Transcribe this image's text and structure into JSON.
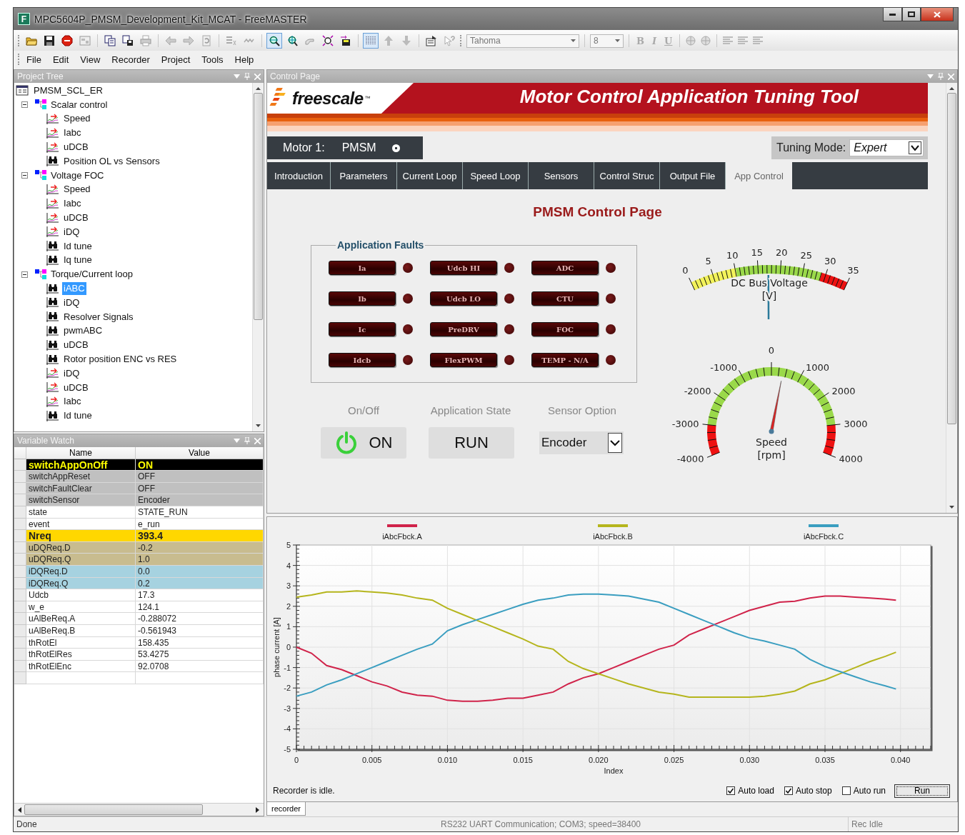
{
  "window": {
    "icon_letter": "F",
    "title": "MPC5604P_PMSM_Development_Kit_MCAT - FreeMASTER"
  },
  "toolbar": {
    "font": "Tahoma",
    "font_size": "8",
    "format_buttons": [
      {
        "label": "B",
        "disabled": true
      },
      {
        "label": "I",
        "disabled": true
      },
      {
        "label": "U",
        "disabled": true
      }
    ]
  },
  "menu": [
    "File",
    "Edit",
    "View",
    "Recorder",
    "Project",
    "Tools",
    "Help"
  ],
  "project_tree": {
    "title": "Project Tree",
    "items": [
      {
        "label": "PMSM_SCL_ER",
        "kind": "project",
        "selected": false,
        "children": [
          {
            "label": "Scalar control",
            "kind": "group",
            "expanded": true,
            "selected": false,
            "children": [
              {
                "label": "Speed",
                "kind": "recorder",
                "selected": false
              },
              {
                "label": "Iabc",
                "kind": "recorder",
                "selected": false
              },
              {
                "label": "uDCB",
                "kind": "recorder",
                "selected": false
              },
              {
                "label": "Position OL vs Sensors",
                "kind": "scope",
                "selected": false
              }
            ]
          },
          {
            "label": "Voltage FOC",
            "kind": "group",
            "expanded": true,
            "selected": false,
            "children": [
              {
                "label": "Speed",
                "kind": "recorder",
                "selected": false
              },
              {
                "label": "Iabc",
                "kind": "recorder",
                "selected": false
              },
              {
                "label": "uDCB",
                "kind": "recorder",
                "selected": false
              },
              {
                "label": "iDQ",
                "kind": "recorder",
                "selected": false
              },
              {
                "label": "Id tune",
                "kind": "scope",
                "selected": false
              },
              {
                "label": "Iq tune",
                "kind": "scope",
                "selected": false
              }
            ]
          },
          {
            "label": "Torque/Current loop",
            "kind": "group",
            "expanded": true,
            "selected": false,
            "children": [
              {
                "label": "iABC",
                "kind": "scope",
                "selected": true
              },
              {
                "label": "iDQ",
                "kind": "scope",
                "selected": false
              },
              {
                "label": "Resolver Signals",
                "kind": "scope",
                "selected": false
              },
              {
                "label": "pwmABC",
                "kind": "scope",
                "selected": false
              },
              {
                "label": "uDCB",
                "kind": "scope",
                "selected": false
              },
              {
                "label": "Rotor position ENC vs RES",
                "kind": "scope",
                "selected": false
              },
              {
                "label": "iDQ",
                "kind": "recorder",
                "selected": false
              },
              {
                "label": "uDCB",
                "kind": "recorder",
                "selected": false
              },
              {
                "label": "Iabc",
                "kind": "recorder",
                "selected": false
              },
              {
                "label": "Id tune",
                "kind": "scope",
                "selected": false
              }
            ]
          }
        ]
      }
    ]
  },
  "variable_watch": {
    "title": "Variable Watch",
    "columns": [
      "Name",
      "Value"
    ],
    "rows": [
      {
        "name": "switchAppOnOff",
        "value": "ON",
        "color": "#000000",
        "bold": true
      },
      {
        "name": "switchAppReset",
        "value": "OFF",
        "color": "#c0c0c0",
        "bold": false
      },
      {
        "name": "switchFaultClear",
        "value": "OFF",
        "color": "#c0c0c0",
        "bold": false
      },
      {
        "name": "switchSensor",
        "value": "Encoder",
        "color": "#c0c0c0",
        "bold": false
      },
      {
        "name": "state",
        "value": "STATE_RUN",
        "color": "#ffffff",
        "bold": false
      },
      {
        "name": "event",
        "value": "e_run",
        "color": "#ffffff",
        "bold": false
      },
      {
        "name": "Nreq",
        "value": "393.4",
        "color": "#ffd700",
        "bold": true
      },
      {
        "name": "uDQReq.D",
        "value": "-0.2",
        "color": "#c8bc8f",
        "bold": false
      },
      {
        "name": "uDQReq.Q",
        "value": "1.0",
        "color": "#c8bc8f",
        "bold": false
      },
      {
        "name": "iDQReq.D",
        "value": "0.0",
        "color": "#a6d2e0",
        "bold": false
      },
      {
        "name": "iDQReq.Q",
        "value": "0.2",
        "color": "#a6d2e0",
        "bold": false
      },
      {
        "name": "Udcb",
        "value": "17.3",
        "color": "#ffffff",
        "bold": false
      },
      {
        "name": "w_e",
        "value": "124.1",
        "color": "#ffffff",
        "bold": false
      },
      {
        "name": "uAlBeReq.A",
        "value": "-0.288072",
        "color": "#ffffff",
        "bold": false
      },
      {
        "name": "uAlBeReq.B",
        "value": "-0.561943",
        "color": "#ffffff",
        "bold": false
      },
      {
        "name": "thRotEl",
        "value": "158.435",
        "color": "#ffffff",
        "bold": false
      },
      {
        "name": "thRotElRes",
        "value": "53.4275",
        "color": "#ffffff",
        "bold": false
      },
      {
        "name": "thRotElEnc",
        "value": "92.0708",
        "color": "#ffffff",
        "bold": false
      }
    ]
  },
  "control_page": {
    "title": "Control Page",
    "banner": {
      "logo": "freescale",
      "logo_mark": "™",
      "title": "Motor Control Application Tuning Tool"
    },
    "motor": {
      "label": "Motor 1:",
      "name": "PMSM",
      "selected": true
    },
    "tuning": {
      "label": "Tuning Mode:",
      "value": "Expert"
    },
    "tabs": [
      {
        "label": "Introduction",
        "selected": false
      },
      {
        "label": "Parameters",
        "selected": false
      },
      {
        "label": "Current Loop",
        "selected": false
      },
      {
        "label": "Speed Loop",
        "selected": false
      },
      {
        "label": "Sensors",
        "selected": false
      },
      {
        "label": "Control Struc",
        "selected": false
      },
      {
        "label": "Output File",
        "selected": false
      },
      {
        "label": "App Control",
        "selected": true
      }
    ],
    "page_title": "PMSM Control Page",
    "faults": {
      "title": "Application Faults",
      "items": [
        {
          "label": "Ia",
          "lit": false
        },
        {
          "label": "Udcb HI",
          "lit": false
        },
        {
          "label": "ADC",
          "lit": false
        },
        {
          "label": "Ib",
          "lit": false
        },
        {
          "label": "Udcb LO",
          "lit": false
        },
        {
          "label": "CTU",
          "lit": false
        },
        {
          "label": "Ic",
          "lit": false
        },
        {
          "label": "PreDRV",
          "lit": false
        },
        {
          "label": "FOC",
          "lit": false
        },
        {
          "label": "Idcb",
          "lit": false
        },
        {
          "label": "FlexPWM",
          "lit": false
        },
        {
          "label": "TEMP - N/A",
          "lit": false
        }
      ]
    },
    "controls": [
      {
        "kind": "power",
        "caption": "On/Off",
        "label": "ON",
        "on": true
      },
      {
        "kind": "button",
        "caption": "Application State",
        "label": "RUN"
      },
      {
        "kind": "select",
        "caption": "Sensor Option",
        "value": "Encoder"
      }
    ],
    "gauges": [
      {
        "kind": "flat",
        "title": "DC Bus Voltage",
        "unit": "[V]",
        "labels": [
          "0",
          "5",
          "10",
          "15",
          "20",
          "25",
          "30",
          "35"
        ],
        "level": 0.494
      },
      {
        "kind": "round",
        "title": "Speed",
        "unit": "[rpm]",
        "labels": [
          "-4000",
          "-3000",
          "-2000",
          "-1000",
          "0",
          "1000",
          "2000",
          "3000",
          "4000"
        ],
        "level": 0.549
      }
    ]
  },
  "recorder": {
    "tab": "recorder",
    "status": "Recorder is idle.",
    "options": [
      {
        "label": "Auto load",
        "checked": true
      },
      {
        "label": "Auto stop",
        "checked": true
      },
      {
        "label": "Auto run",
        "checked": false
      }
    ],
    "run_button": "Run",
    "chart_data": {
      "type": "line",
      "xlabel": "Index",
      "ylabel": "phase current [A]",
      "x": [
        0,
        0.001,
        0.002,
        0.003,
        0.004,
        0.005,
        0.006,
        0.007,
        0.008,
        0.009,
        0.01,
        0.011,
        0.012,
        0.013,
        0.014,
        0.015,
        0.016,
        0.017,
        0.018,
        0.019,
        0.02,
        0.021,
        0.022,
        0.023,
        0.024,
        0.025,
        0.026,
        0.027,
        0.028,
        0.029,
        0.03,
        0.031,
        0.032,
        0.033,
        0.034,
        0.035,
        0.036,
        0.037,
        0.038,
        0.039,
        0.0397
      ],
      "series": [
        {
          "name": "iAbcFbck.A",
          "color": "#d0234a",
          "values": [
            0,
            -0.3,
            -0.9,
            -1.1,
            -1.4,
            -1.7,
            -1.9,
            -2.2,
            -2.35,
            -2.4,
            -2.6,
            -2.65,
            -2.65,
            -2.6,
            -2.5,
            -2.5,
            -2.35,
            -2.2,
            -1.8,
            -1.5,
            -1.3,
            -1.0,
            -0.7,
            -0.4,
            -0.1,
            0.1,
            0.6,
            0.9,
            1.2,
            1.5,
            1.8,
            2.0,
            2.2,
            2.25,
            2.4,
            2.5,
            2.5,
            2.45,
            2.4,
            2.35,
            2.3
          ]
        },
        {
          "name": "iAbcFbck.B",
          "color": "#b5b51c",
          "values": [
            2.45,
            2.55,
            2.7,
            2.7,
            2.75,
            2.7,
            2.65,
            2.55,
            2.4,
            2.3,
            1.9,
            1.6,
            1.3,
            1.0,
            0.7,
            0.4,
            0.05,
            -0.1,
            -0.7,
            -1.05,
            -1.3,
            -1.55,
            -1.8,
            -2.0,
            -2.2,
            -2.3,
            -2.45,
            -2.45,
            -2.45,
            -2.45,
            -2.45,
            -2.4,
            -2.3,
            -2.15,
            -1.8,
            -1.6,
            -1.3,
            -1.0,
            -0.7,
            -0.45,
            -0.25
          ]
        },
        {
          "name": "iAbcFbck.C",
          "color": "#3a9ec0",
          "values": [
            -2.4,
            -2.2,
            -1.85,
            -1.6,
            -1.3,
            -1.0,
            -0.7,
            -0.4,
            -0.1,
            0.15,
            0.8,
            1.1,
            1.35,
            1.6,
            1.85,
            2.1,
            2.3,
            2.4,
            2.55,
            2.6,
            2.6,
            2.55,
            2.5,
            2.35,
            2.2,
            1.9,
            1.6,
            1.3,
            1.0,
            0.7,
            0.45,
            0.3,
            0.1,
            -0.1,
            -0.6,
            -0.95,
            -1.2,
            -1.45,
            -1.7,
            -1.9,
            -2.05
          ]
        }
      ],
      "xlim": [
        0,
        0.042
      ],
      "ylim": [
        -5,
        5
      ],
      "grid": true,
      "legend": "top",
      "xticks": [
        {
          "value": 0,
          "label": "0"
        },
        {
          "value": 0.005,
          "label": "0.005"
        },
        {
          "value": 0.01,
          "label": "0.010"
        },
        {
          "value": 0.015,
          "label": "0.015"
        },
        {
          "value": 0.02,
          "label": "0.020"
        },
        {
          "value": 0.025,
          "label": "0.025"
        },
        {
          "value": 0.03,
          "label": "0.030"
        },
        {
          "value": 0.035,
          "label": "0.035"
        },
        {
          "value": 0.04,
          "label": "0.040"
        }
      ],
      "yticks": [
        -5,
        -4,
        -3,
        -2,
        -1,
        0,
        1,
        2,
        3,
        4,
        5
      ]
    }
  },
  "status_bar": {
    "left": "Done",
    "center": "RS232 UART Communication; COM3; speed=38400",
    "right": "Rec Idle"
  }
}
